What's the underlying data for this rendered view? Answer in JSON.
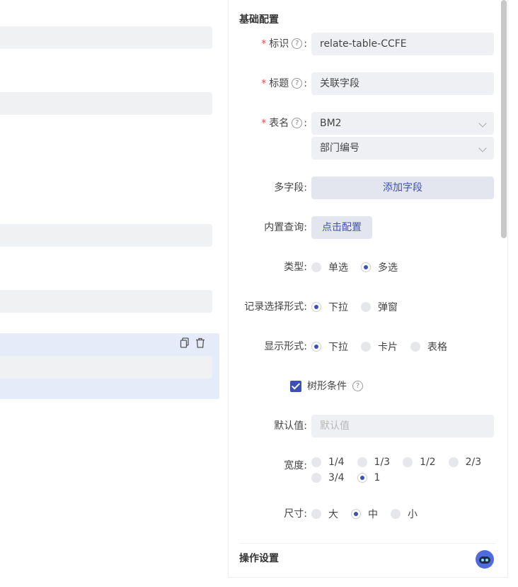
{
  "canvas": {
    "block_icons": [
      "copy-icon",
      "delete-icon"
    ]
  },
  "panel": {
    "basic_title": "基础配置",
    "fields": {
      "id_label": "标识",
      "id_value": "relate-table-CCFE",
      "title_label": "标题",
      "title_value": "关联字段",
      "table_label": "表名",
      "table_value": "BM2",
      "table_field_value": "部门编号",
      "multi_label": "多字段:",
      "multi_button": "添加字段",
      "query_label": "内置查询:",
      "query_button": "点击配置",
      "type_label": "类型:",
      "type_options": [
        "单选",
        "多选"
      ],
      "type_selected": "多选",
      "record_label": "记录选择形式:",
      "record_options": [
        "下拉",
        "弹窗"
      ],
      "record_selected": "下拉",
      "display_label": "显示形式:",
      "display_options": [
        "下拉",
        "卡片",
        "表格"
      ],
      "display_selected": "下拉",
      "tree_label": "树形条件",
      "tree_checked": true,
      "default_label": "默认值:",
      "default_placeholder": "默认值",
      "width_label": "宽度:",
      "width_options_row1": [
        "1/4",
        "1/3",
        "1/2",
        "2/3"
      ],
      "width_options_row2": [
        "3/4",
        "1"
      ],
      "width_selected": "1",
      "size_label": "尺寸:",
      "size_options": [
        "大",
        "中",
        "小"
      ],
      "size_selected": "中"
    },
    "ops_title": "操作设置"
  },
  "colors": {
    "accent": "#3d50b5",
    "field_bg": "#eff0f3",
    "selected_block": "#e6ebfa",
    "required": "#e5484d"
  }
}
